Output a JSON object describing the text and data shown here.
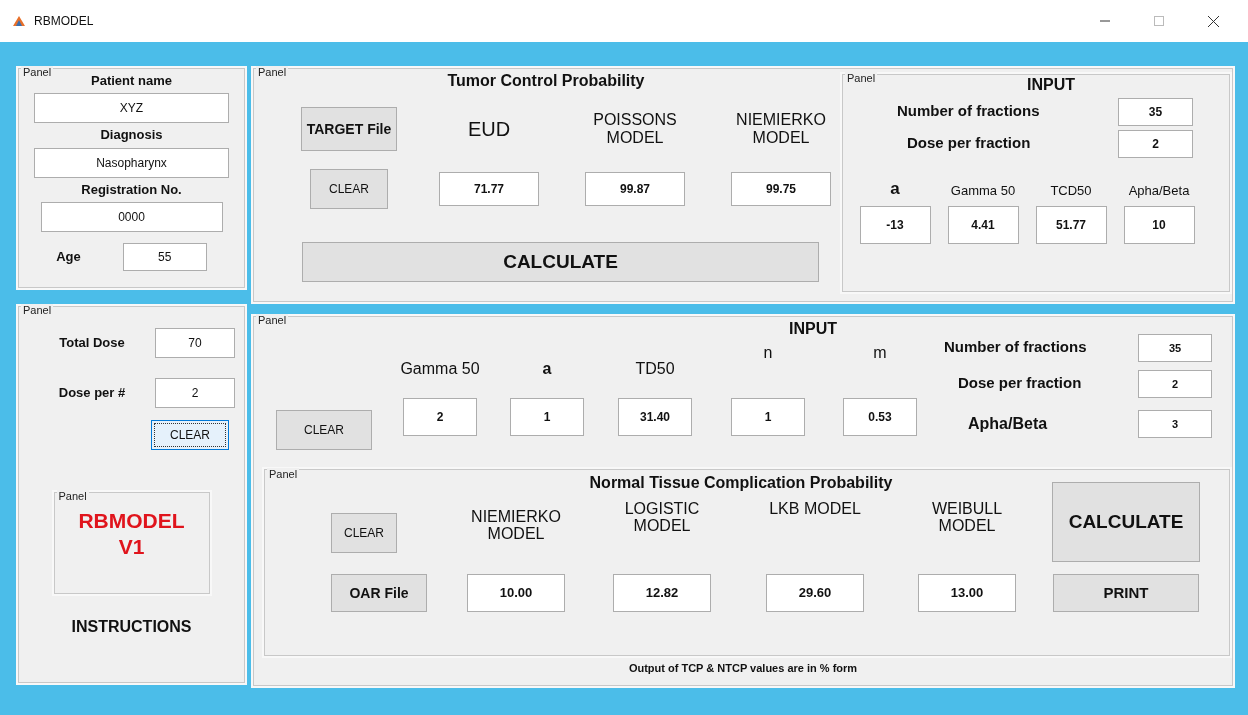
{
  "window": {
    "title": "RBMODEL"
  },
  "patient_panel": {
    "title": "Panel",
    "fields": [
      {
        "label": "Patient name",
        "value": "XYZ"
      },
      {
        "label": "Diagnosis",
        "value": "Nasopharynx"
      },
      {
        "label": "Registration No.",
        "value": "0000"
      }
    ],
    "age": {
      "label": "Age",
      "value": "55"
    }
  },
  "dose_panel": {
    "title": "Panel",
    "fields": [
      {
        "label": "Total Dose",
        "value": "70"
      },
      {
        "label": "Dose per #",
        "value": "2"
      }
    ],
    "clear_button": {
      "label": "CLEAR",
      "focused": true
    },
    "logo_panel": {
      "title": "Panel",
      "lines": [
        "RBMODEL",
        "V1"
      ]
    },
    "instructions": "INSTRUCTIONS"
  },
  "tcp_panel": {
    "title": "Panel",
    "heading": "Tumor Control Probability",
    "target_button": "TARGET File",
    "clear_button": "CLEAR",
    "outputs": [
      {
        "label": "EUD",
        "value": "71.77"
      },
      {
        "label": "POISSONS MODEL",
        "value": "99.87"
      },
      {
        "label": "NIEMIERKO MODEL",
        "value": "99.75"
      }
    ],
    "calculate_button": "CALCULATE",
    "input_panel": {
      "title": "Panel",
      "heading": "INPUT",
      "rows": [
        {
          "label": "Number of fractions",
          "value": "35"
        },
        {
          "label": "Dose per fraction",
          "value": "2"
        }
      ],
      "params": [
        {
          "label": "a",
          "value": "-13",
          "bold": true
        },
        {
          "label": "Gamma 50",
          "value": "4.41",
          "bold": false
        },
        {
          "label": "TCD50",
          "value": "51.77",
          "bold": false
        },
        {
          "label": "Apha/Beta",
          "value": "10",
          "bold": false
        }
      ]
    }
  },
  "ntcp_input_panel": {
    "title": "Panel",
    "heading": "INPUT",
    "clear_button": "CLEAR",
    "params": [
      {
        "label": "Gamma 50",
        "value": "2",
        "bold": false
      },
      {
        "label": "a",
        "value": "1",
        "bold": true
      },
      {
        "label": "TD50",
        "value": "31.40",
        "bold": false
      },
      {
        "label": "n",
        "value": "1",
        "bold": false
      },
      {
        "label": "m",
        "value": "0.53",
        "bold": false
      }
    ],
    "rows": [
      {
        "label": "Number of fractions",
        "value": "35"
      },
      {
        "label": "Dose per fraction",
        "value": "2"
      },
      {
        "label": "Apha/Beta",
        "value": "3"
      }
    ],
    "ntcp_panel": {
      "title": "Panel",
      "heading": "Normal Tissue Complication Probability",
      "clear_button": "CLEAR",
      "oar_button": "OAR File",
      "outputs": [
        {
          "label": "NIEMIERKO MODEL",
          "value": "10.00"
        },
        {
          "label": "LOGISTIC MODEL",
          "value": "12.82"
        },
        {
          "label": "LKB MODEL",
          "value": "29.60"
        },
        {
          "label": "WEIBULL MODEL",
          "value": "13.00"
        }
      ],
      "calculate_button": "CALCULATE",
      "print_button": "PRINT"
    },
    "footnote": "Output of TCP & NTCP values are in % form"
  }
}
